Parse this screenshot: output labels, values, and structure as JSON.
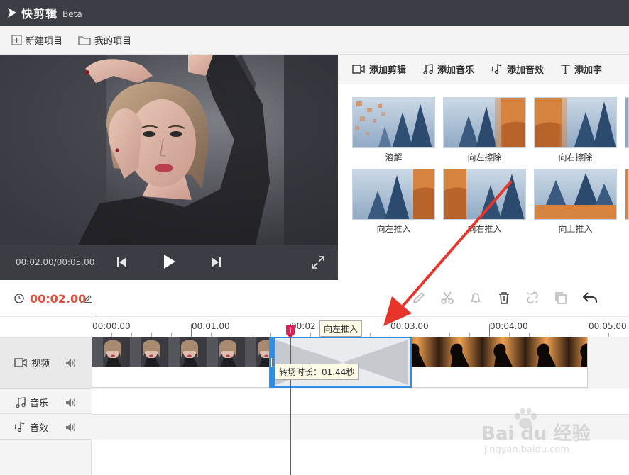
{
  "titlebar": {
    "app_name": "快剪辑",
    "beta": "Beta"
  },
  "menubar": {
    "new_project": "新建项目",
    "my_projects": "我的项目"
  },
  "player": {
    "time": "00:02.00/00:05.00"
  },
  "tabs": {
    "add_clip": "添加剪辑",
    "add_music": "添加音乐",
    "add_sfx": "添加音效",
    "add_text": "添加字"
  },
  "transitions": [
    {
      "label": "溶解"
    },
    {
      "label": "向左擦除"
    },
    {
      "label": "向右擦除"
    },
    {
      "label": "向左推入"
    },
    {
      "label": "向右推入"
    },
    {
      "label": "向上推入"
    }
  ],
  "timeline": {
    "current_time": "00:02.00",
    "ruler": [
      "00:00.00",
      "00:01.00",
      "00:02.0",
      "00:03.00",
      "00:04.00",
      "00:05.00"
    ],
    "transition_tooltip": "向左推入",
    "transition_duration": "转场时长：01.44秒"
  },
  "tracks": {
    "video": "视频",
    "music": "音乐",
    "sfx": "音效"
  },
  "watermark": {
    "brand": "Bai du 经验",
    "url": "jingyan.baidu.com"
  },
  "colors": {
    "accent": "#e1503b",
    "titlebar": "#3b3e45",
    "selection": "#2f8de4",
    "playhead": "#d6245a"
  }
}
